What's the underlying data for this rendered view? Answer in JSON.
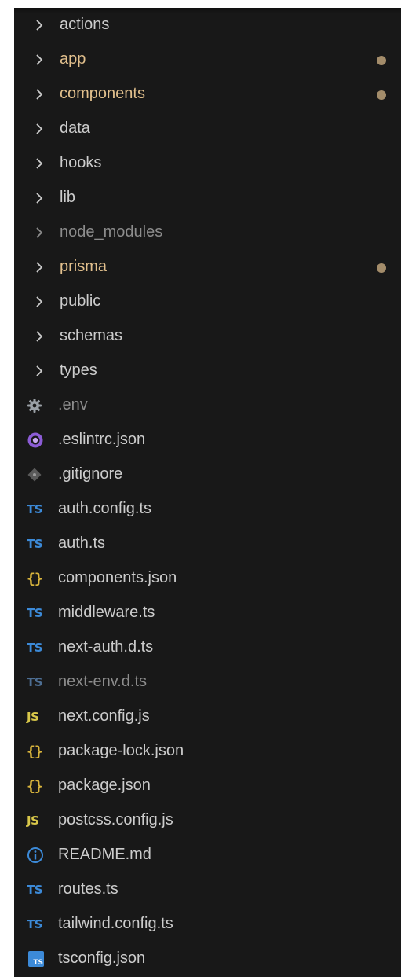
{
  "explorer": {
    "folders": [
      {
        "label": "actions",
        "icon": "chevron-right-icon"
      },
      {
        "label": "app",
        "icon": "chevron-right-icon",
        "modified": true
      },
      {
        "label": "components",
        "icon": "chevron-right-icon",
        "modified": true
      },
      {
        "label": "data",
        "icon": "chevron-right-icon"
      },
      {
        "label": "hooks",
        "icon": "chevron-right-icon"
      },
      {
        "label": "lib",
        "icon": "chevron-right-icon"
      },
      {
        "label": "node_modules",
        "icon": "chevron-right-icon",
        "ignored": true
      },
      {
        "label": "prisma",
        "icon": "chevron-right-icon",
        "modified": true
      },
      {
        "label": "public",
        "icon": "chevron-right-icon"
      },
      {
        "label": "schemas",
        "icon": "chevron-right-icon"
      },
      {
        "label": "types",
        "icon": "chevron-right-icon"
      }
    ],
    "files": [
      {
        "label": ".env",
        "icon": "gear-icon",
        "ignored": true
      },
      {
        "label": ".eslintrc.json",
        "icon": "eslint-icon"
      },
      {
        "label": ".gitignore",
        "icon": "git-icon"
      },
      {
        "label": "auth.config.ts",
        "icon": "typescript-icon",
        "badge": "TS"
      },
      {
        "label": "auth.ts",
        "icon": "typescript-icon",
        "badge": "TS"
      },
      {
        "label": "components.json",
        "icon": "json-icon",
        "badge": "{}"
      },
      {
        "label": "middleware.ts",
        "icon": "typescript-icon",
        "badge": "TS"
      },
      {
        "label": "next-auth.d.ts",
        "icon": "typescript-icon",
        "badge": "TS"
      },
      {
        "label": "next-env.d.ts",
        "icon": "typescript-icon",
        "badge": "TS",
        "ignored": true
      },
      {
        "label": "next.config.js",
        "icon": "javascript-icon",
        "badge": "JS"
      },
      {
        "label": "package-lock.json",
        "icon": "json-icon",
        "badge": "{}"
      },
      {
        "label": "package.json",
        "icon": "json-icon",
        "badge": "{}"
      },
      {
        "label": "postcss.config.js",
        "icon": "javascript-icon",
        "badge": "JS"
      },
      {
        "label": "README.md",
        "icon": "info-icon"
      },
      {
        "label": "routes.ts",
        "icon": "typescript-icon",
        "badge": "TS"
      },
      {
        "label": "tailwind.config.ts",
        "icon": "typescript-icon",
        "badge": "TS"
      },
      {
        "label": "tsconfig.json",
        "icon": "tsconfig-icon",
        "badge": "TS"
      }
    ]
  },
  "colors": {
    "background": "#181818",
    "text": "#cccccc",
    "text_ignored": "#8c8c8c",
    "text_modified": "#e2c08d",
    "modified_dot": "#a38c6a",
    "typescript": "#3c8ad8",
    "javascript": "#d9c84a",
    "json": "#d8b43c",
    "eslint": "#8c5cd6",
    "git": "#6e6e6e",
    "gear": "#9aa0a6",
    "info": "#3c8ad8"
  }
}
